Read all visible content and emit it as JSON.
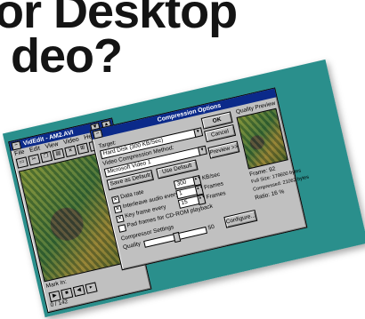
{
  "headline": {
    "line1": "or Desktop",
    "line2": "deo?"
  },
  "videdit": {
    "title": "VidEdit - AM2.AVI",
    "menus": [
      "File",
      "Edit",
      "View",
      "Video",
      "Help"
    ],
    "mark_in": "Mark In:",
    "status": "0 / 142"
  },
  "dialog": {
    "title": "Compression Options",
    "target_label": "Target:",
    "target_value": "Hard Disk (300 KB/Sec)",
    "method_label": "Video Compression Method:",
    "method_value": "Microsoft Video 1",
    "save_default": "Save as Default",
    "use_default": "Use Default",
    "ok": "OK",
    "cancel": "Cancel",
    "preview_btn": "Preview >>",
    "data_rate_label": "Data rate",
    "data_rate_value": "300",
    "data_rate_unit": "KB/sec",
    "interleave_label": "Interleave audio every",
    "interleave_value": "1",
    "interleave_unit": "Frames",
    "keyframe_label": "Key frame every",
    "keyframe_value": "15",
    "keyframe_unit": "Frames",
    "pad_label": "Pad frames for CD-ROM playback",
    "settings_label": "Compressor Settings",
    "quality_label": "Quality",
    "quality_value": "50",
    "configure": "Configure...",
    "quality_preview_label": "Quality Preview",
    "frame_info": "Frame: 92",
    "full_size": "Full Size: 179600 bytes",
    "compressed": "Compressed: 21062 bytes",
    "ratio": "Ratio: 16 %"
  },
  "checks": {
    "data_rate": true,
    "interleave": true,
    "keyframe": true,
    "pad": false
  },
  "quality_level": 0.5
}
